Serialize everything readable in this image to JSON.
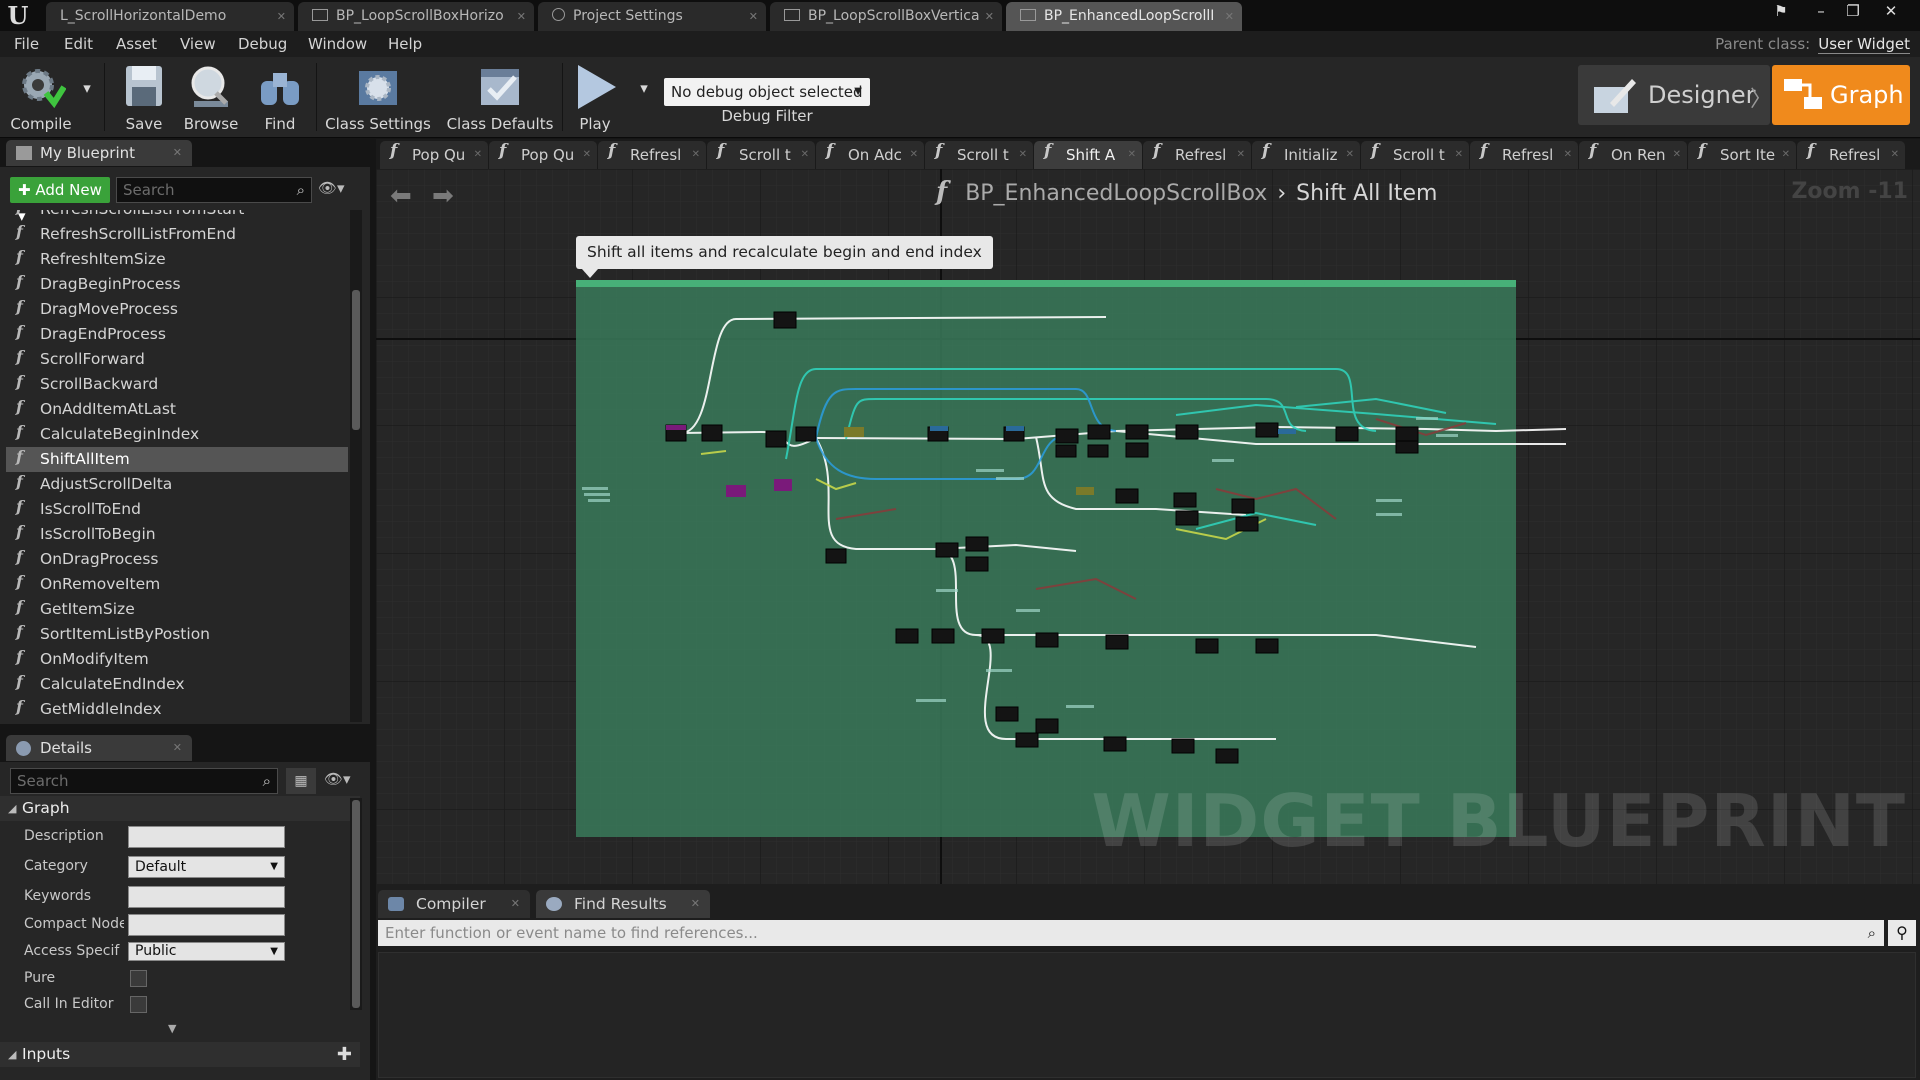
{
  "window": {
    "logo": "U",
    "tabs": [
      {
        "label": "L_ScrollHorizontalDemo"
      },
      {
        "label": "BP_LoopScrollBoxHorizo"
      },
      {
        "label": "Project Settings"
      },
      {
        "label": "BP_LoopScrollBoxVertica"
      },
      {
        "label": "BP_EnhancedLoopScrollI"
      }
    ]
  },
  "menu": {
    "items": [
      "File",
      "Edit",
      "Asset",
      "View",
      "Debug",
      "Window",
      "Help"
    ],
    "parent_class_label": "Parent class:",
    "parent_class_value": "User Widget"
  },
  "toolbar": {
    "compile": "Compile",
    "save": "Save",
    "browse": "Browse",
    "find": "Find",
    "class_settings": "Class Settings",
    "class_defaults": "Class Defaults",
    "play": "Play",
    "debug_object": "No debug object selected",
    "debug_filter": "Debug Filter",
    "designer": "Designer",
    "graph": "Graph"
  },
  "my_blueprint": {
    "tab": "My Blueprint",
    "add_new": "Add New",
    "search_placeholder": "Search",
    "functions": [
      "RefreshScrollListFromStart",
      "RefreshScrollListFromEnd",
      "RefreshItemSize",
      "DragBeginProcess",
      "DragMoveProcess",
      "DragEndProcess",
      "ScrollForward",
      "ScrollBackward",
      "OnAddItemAtLast",
      "CalculateBeginIndex",
      "ShiftAllItem",
      "AdjustScrollDelta",
      "IsScrollToEnd",
      "IsScrollToBegin",
      "OnDragProcess",
      "OnRemoveItem",
      "GetItemSize",
      "SortItemListByPostion",
      "OnModifyItem",
      "CalculateEndIndex",
      "GetMiddleIndex"
    ]
  },
  "details": {
    "tab": "Details",
    "search_placeholder": "Search",
    "graph_header": "Graph",
    "labels": {
      "description": "Description",
      "category": "Category",
      "keywords": "Keywords",
      "compact_node": "Compact Node",
      "access_specifier": "Access Specif",
      "pure": "Pure",
      "call_in_editor": "Call In Editor"
    },
    "values": {
      "category": "Default",
      "access_specifier": "Public"
    },
    "inputs_header": "Inputs"
  },
  "function_tabs": [
    "Pop Qu",
    "Pop Qu",
    "Refresl",
    "Scroll t",
    "On Adc",
    "Scroll t",
    "Shift A",
    "Refresl",
    "Initializ",
    "Scroll t",
    "Refresl",
    "On Ren",
    "Sort Ite",
    "Refresl"
  ],
  "graph": {
    "blueprint_name": "BP_EnhancedLoopScrollBox",
    "function_name": "Shift All Item",
    "zoom": "Zoom -11",
    "comment": "Shift all items and recalculate begin and end index",
    "watermark": "WIDGET BLUEPRINT",
    "colors": {
      "comment_bg": "#3a7a5a",
      "comment_header": "#47b078",
      "exec_wire": "#ffffff",
      "cyan_wire": "#2fd6c0",
      "blue_wire": "#2b9ee0"
    }
  },
  "bottom": {
    "tabs": [
      "Compiler Results",
      "Find Results"
    ],
    "find_placeholder": "Enter function or event name to find references..."
  }
}
